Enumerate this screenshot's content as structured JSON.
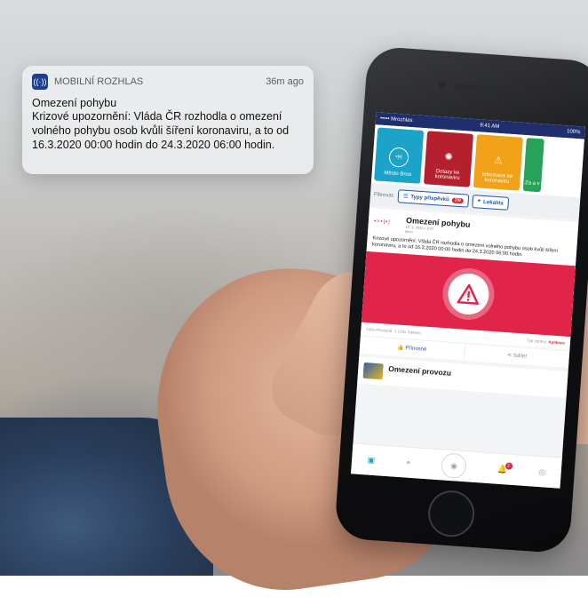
{
  "notification": {
    "app_name": "MOBILNÍ ROZHLAS",
    "time": "36m ago",
    "title": "Omezení pohybu",
    "text": "Krizové upozornění: Vláda ČR rozhodla o omezení volného pohybu osob kvůli šíření koronaviru, a to od 16.3.2020 00:00 hodin do 24.3.2020 06:00 hodin.",
    "icon": "radio-broadcast-icon"
  },
  "phone": {
    "status": {
      "carrier": "••••• Mrozhlas",
      "time": "9:41 AM",
      "battery": "100%"
    },
    "tiles": [
      {
        "label": "Město Brno",
        "icon": "city-logo-icon",
        "color": "#1ca3c9"
      },
      {
        "label": "Dotazy ke koronaviru",
        "icon": "virus-icon",
        "color": "#b5202f"
      },
      {
        "label": "Informace ke koronaviru",
        "icon": "warning-icon",
        "color": "#f1a218"
      },
      {
        "label": "Za a v",
        "icon": "",
        "color": "#26a25a"
      }
    ],
    "filter": {
      "label": "Filtrovat:",
      "types_button": "Typy příspěvků",
      "types_count": "7/9",
      "location_button": "Lokalita"
    },
    "post": {
      "logo": "•>•|•|",
      "title": "Omezení pohybu",
      "meta1": "15. 3. 2020 v 8:57",
      "meta2": "Brno",
      "text": "Krizové upozornění: Vláda ČR rozhodla o omezení volného pohybu osob kvůli šíření koronaviru, a to od 16.3.2020 00:00 hodin do 24.3.2020 06:00 hodin.",
      "useful_count": "100x Přínosné",
      "shared_count": "1 120x Sdíleno",
      "type_label": "Typ zprávy:",
      "type_value": "Aplikace",
      "action_useful": "Přínosné",
      "action_share": "Sdílet"
    },
    "post2": {
      "title": "Omezení provozu"
    },
    "tabbar": {
      "notif_count": "2"
    }
  }
}
